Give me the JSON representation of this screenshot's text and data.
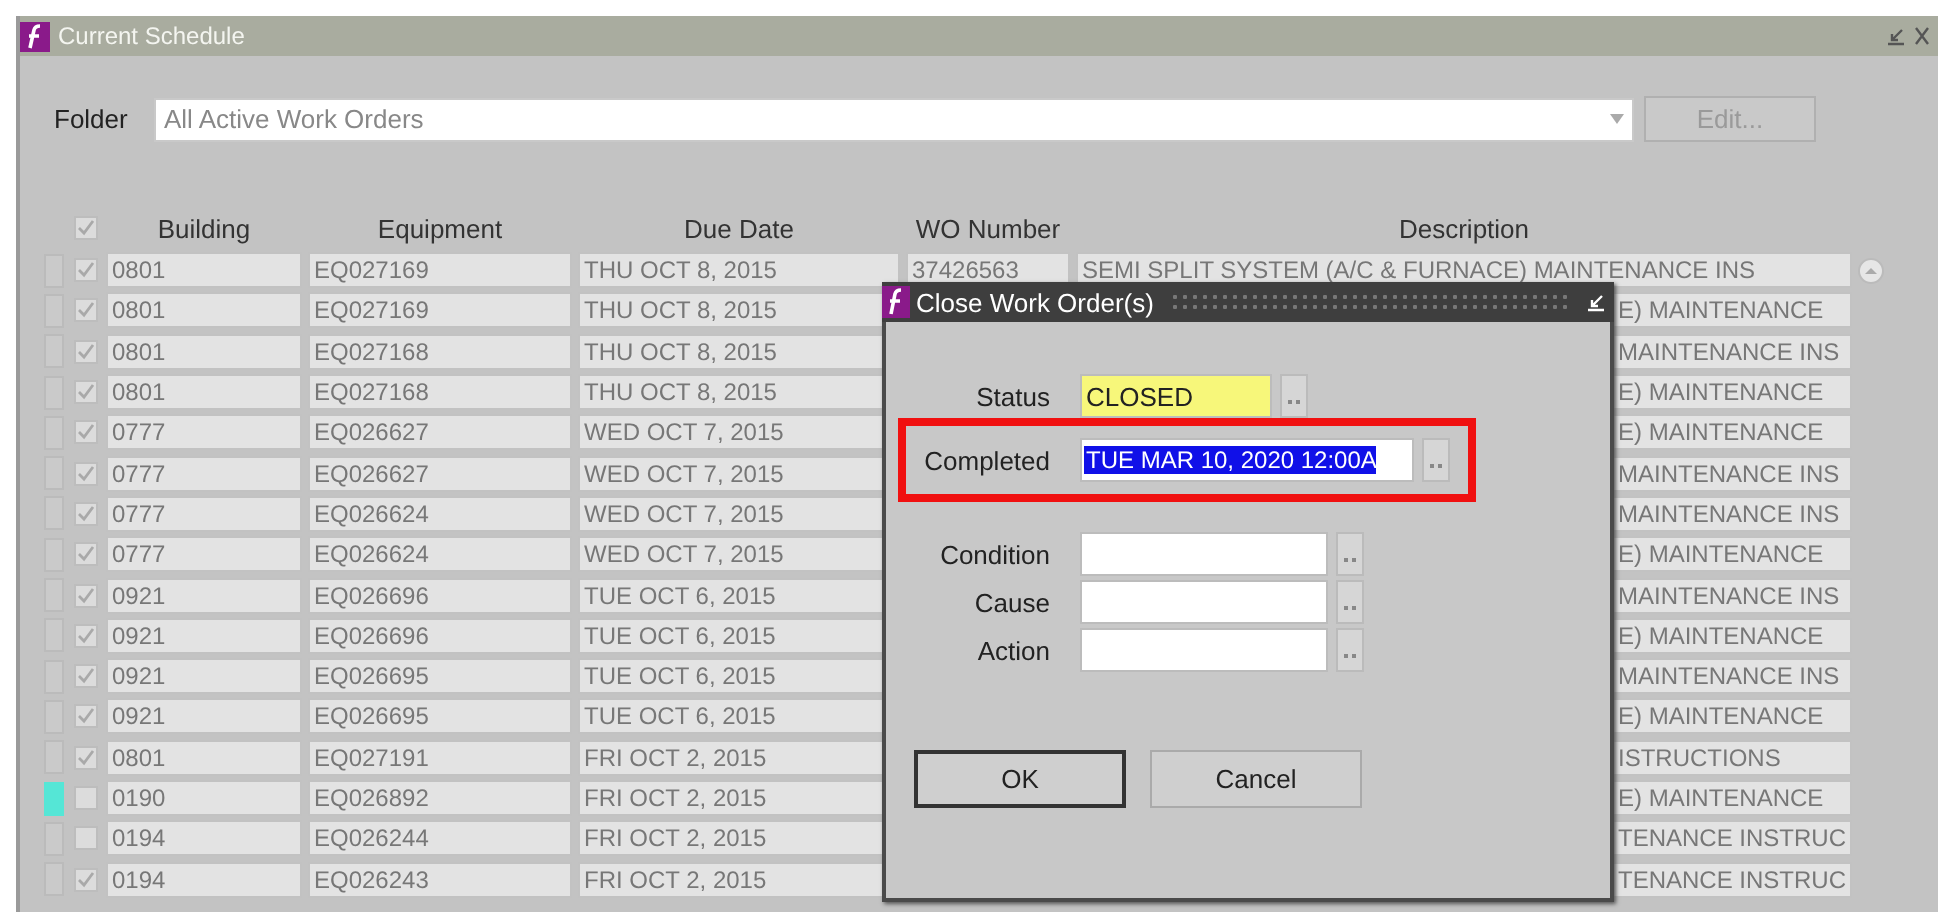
{
  "window": {
    "title": "Current Schedule"
  },
  "folder": {
    "label": "Folder",
    "value": "All Active Work Orders",
    "edit_button": {
      "label": "Edit...",
      "disabled": true
    }
  },
  "table": {
    "header_checked": true,
    "columns": [
      "Building",
      "Equipment",
      "Due Date",
      "WO Number",
      "Description"
    ],
    "rows": [
      {
        "current": false,
        "checked": true,
        "building": "0801",
        "equipment": "EQ027169",
        "due_date": "THU OCT 8, 2015",
        "wo_number": "37426563",
        "description": "SEMI SPLIT SYSTEM (A/C & FURNACE) MAINTENANCE INS"
      },
      {
        "current": false,
        "checked": true,
        "building": "0801",
        "equipment": "EQ027169",
        "due_date": "THU OCT 8, 2015",
        "description": "E) MAINTENANCE"
      },
      {
        "current": false,
        "checked": true,
        "building": "0801",
        "equipment": "EQ027168",
        "due_date": "THU OCT 8, 2015",
        "description": "MAINTENANCE INS"
      },
      {
        "current": false,
        "checked": true,
        "building": "0801",
        "equipment": "EQ027168",
        "due_date": "THU OCT 8, 2015",
        "description": "E) MAINTENANCE"
      },
      {
        "current": false,
        "checked": true,
        "building": "0777",
        "equipment": "EQ026627",
        "due_date": "WED OCT 7, 2015",
        "description": "E) MAINTENANCE"
      },
      {
        "current": false,
        "checked": true,
        "building": "0777",
        "equipment": "EQ026627",
        "due_date": "WED OCT 7, 2015",
        "description": "MAINTENANCE INS"
      },
      {
        "current": false,
        "checked": true,
        "building": "0777",
        "equipment": "EQ026624",
        "due_date": "WED OCT 7, 2015",
        "description": "MAINTENANCE INS"
      },
      {
        "current": false,
        "checked": true,
        "building": "0777",
        "equipment": "EQ026624",
        "due_date": "WED OCT 7, 2015",
        "description": "E) MAINTENANCE"
      },
      {
        "current": false,
        "checked": true,
        "building": "0921",
        "equipment": "EQ026696",
        "due_date": "TUE OCT 6, 2015",
        "description": "MAINTENANCE INS"
      },
      {
        "current": false,
        "checked": true,
        "building": "0921",
        "equipment": "EQ026696",
        "due_date": "TUE OCT 6, 2015",
        "description": "E) MAINTENANCE"
      },
      {
        "current": false,
        "checked": true,
        "building": "0921",
        "equipment": "EQ026695",
        "due_date": "TUE OCT 6, 2015",
        "description": "MAINTENANCE INS"
      },
      {
        "current": false,
        "checked": true,
        "building": "0921",
        "equipment": "EQ026695",
        "due_date": "TUE OCT 6, 2015",
        "description": "E) MAINTENANCE"
      },
      {
        "current": false,
        "checked": true,
        "building": "0801",
        "equipment": "EQ027191",
        "due_date": "FRI OCT 2, 2015",
        "description": "ISTRUCTIONS"
      },
      {
        "current": true,
        "checked": false,
        "building": "0190",
        "equipment": "EQ026892",
        "due_date": "FRI OCT 2, 2015",
        "description": "E) MAINTENANCE"
      },
      {
        "current": false,
        "checked": false,
        "building": "0194",
        "equipment": "EQ026244",
        "due_date": "FRI OCT 2, 2015",
        "description": "TENANCE INSTRUC"
      },
      {
        "current": false,
        "checked": true,
        "building": "0194",
        "equipment": "EQ026243",
        "due_date": "FRI OCT 2, 2015",
        "description": "TENANCE INSTRUC"
      }
    ]
  },
  "dialog": {
    "title": "Close Work Order(s)",
    "fields": [
      {
        "label": "Status",
        "value": "CLOSED",
        "required": true,
        "text_selected": false,
        "highlighted": false,
        "kind": "short"
      },
      {
        "label": "Completed",
        "value": "TUE MAR 10, 2020 12:00A",
        "required": false,
        "text_selected": true,
        "highlighted": true,
        "kind": "long"
      },
      {
        "label": "Condition",
        "required": false,
        "highlighted": false,
        "kind": "medium"
      },
      {
        "label": "Cause",
        "required": false,
        "highlighted": false,
        "kind": "medium"
      },
      {
        "label": "Action",
        "required": false,
        "highlighted": false,
        "kind": "medium"
      }
    ],
    "buttons": [
      {
        "label": "OK",
        "default": true
      },
      {
        "label": "Cancel",
        "default": false
      }
    ]
  }
}
